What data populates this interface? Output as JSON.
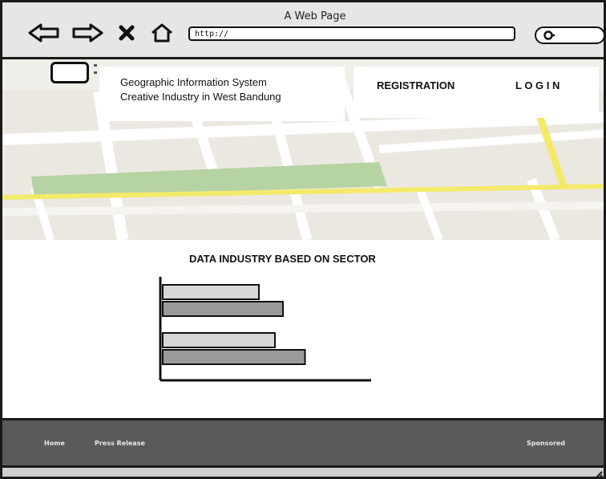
{
  "window": {
    "title": "A Web Page"
  },
  "browser": {
    "url": "http://",
    "icons": [
      "back-arrow-icon",
      "forward-arrow-icon",
      "close-x-icon",
      "home-icon",
      "search-icon"
    ]
  },
  "header": {
    "title_line1": "Geographic Information System",
    "title_line2": "Creative Industry in West Bandung",
    "nav": {
      "registration": "REGISTRATION",
      "login": "L O G I N"
    }
  },
  "chart_data": {
    "type": "bar",
    "orientation": "horizontal",
    "title": "DATA INDUSTRY BASED ON SECTOR",
    "categories": [
      "",
      ""
    ],
    "series": [
      {
        "values": [
          48,
          56
        ],
        "color": "#d8d8d8"
      },
      {
        "values": [
          60,
          71
        ],
        "color": "#9a9a9a"
      }
    ],
    "xlim": [
      0,
      100
    ],
    "grid": false,
    "legend": false
  },
  "footer": {
    "links": [
      "Home",
      "Press Release"
    ],
    "right_label": "Sponsored"
  },
  "colors": {
    "chrome": "#e6e6e6",
    "map_road_yellow": "#f4e96a",
    "map_park": "#b6d3a3",
    "footer": "#5a5a5a"
  }
}
